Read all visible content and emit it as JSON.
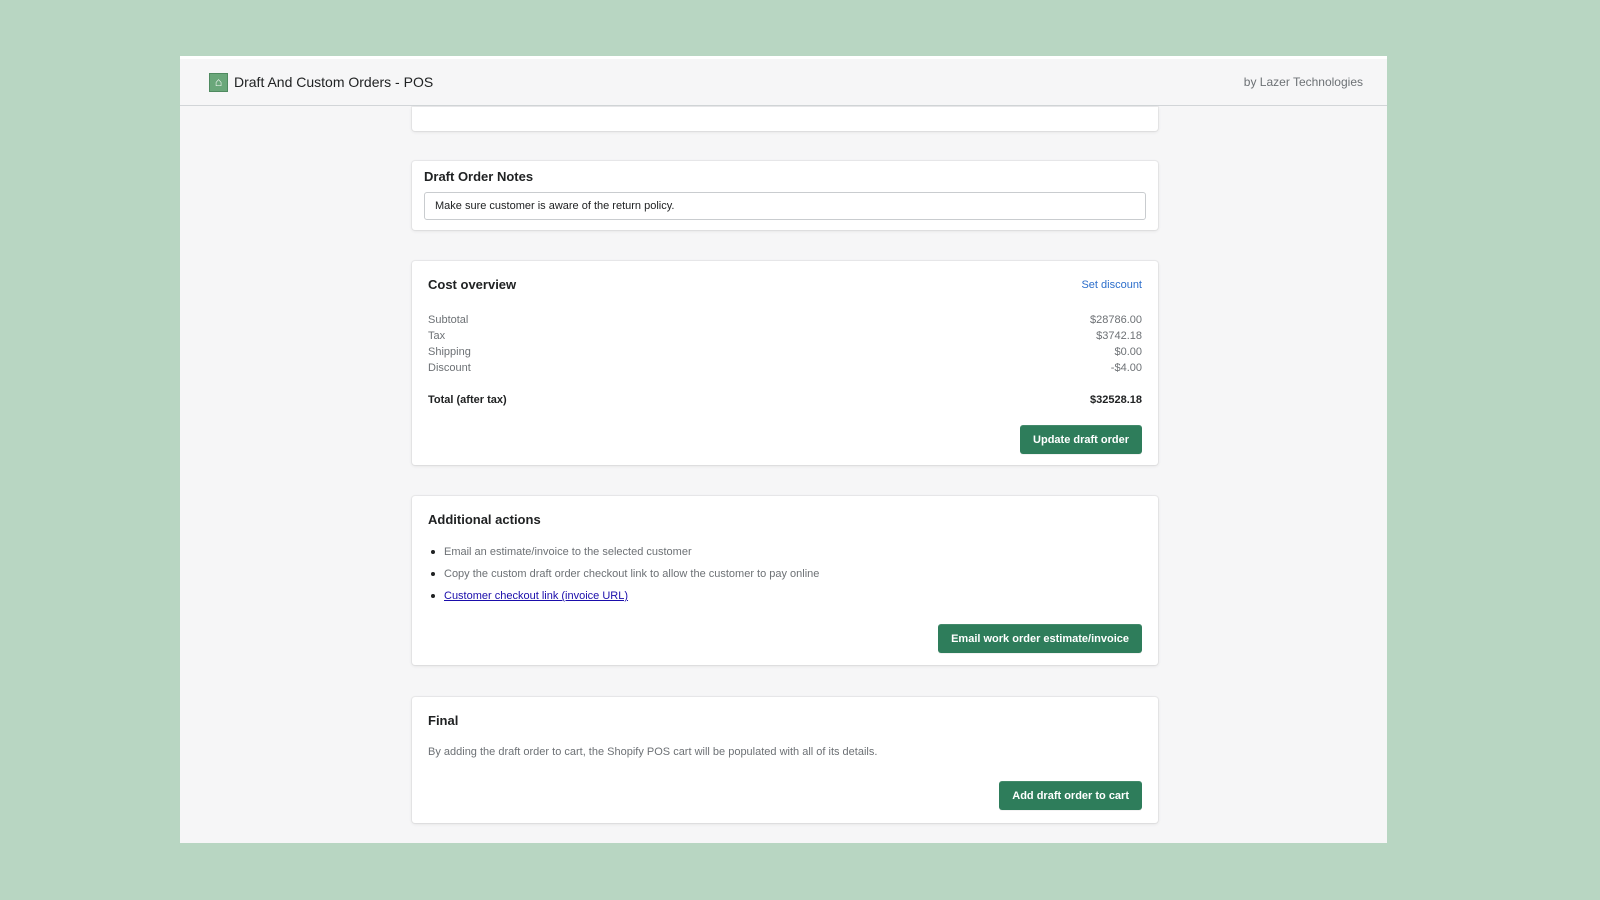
{
  "header": {
    "app_title": "Draft And Custom Orders - POS",
    "vendor": "by Lazer Technologies",
    "logo_icon": "store-icon"
  },
  "notes": {
    "title": "Draft Order Notes",
    "value": "Make sure customer is aware of the return policy."
  },
  "cost": {
    "title": "Cost overview",
    "set_discount_label": "Set discount",
    "lines": [
      {
        "label": "Subtotal",
        "value": "$28786.00"
      },
      {
        "label": "Tax",
        "value": "$3742.18"
      },
      {
        "label": "Shipping",
        "value": "$0.00"
      },
      {
        "label": "Discount",
        "value": "-$4.00"
      }
    ],
    "total_label": "Total (after tax)",
    "total_value": "$32528.18",
    "update_button": "Update draft order"
  },
  "actions": {
    "title": "Additional actions",
    "items": [
      "Email an estimate/invoice to the selected customer",
      "Copy the custom draft order checkout link to allow the customer to pay online"
    ],
    "invoice_link": "Customer checkout link (invoice URL)",
    "email_button": "Email work order estimate/invoice"
  },
  "final": {
    "title": "Final",
    "description": "By adding the draft order to cart, the Shopify POS cart will be populated with all of its details.",
    "add_button": "Add draft order to cart"
  },
  "colors": {
    "background": "#b8d6c2",
    "primary_button": "#2e7d5b",
    "link": "#2c6ecb"
  }
}
